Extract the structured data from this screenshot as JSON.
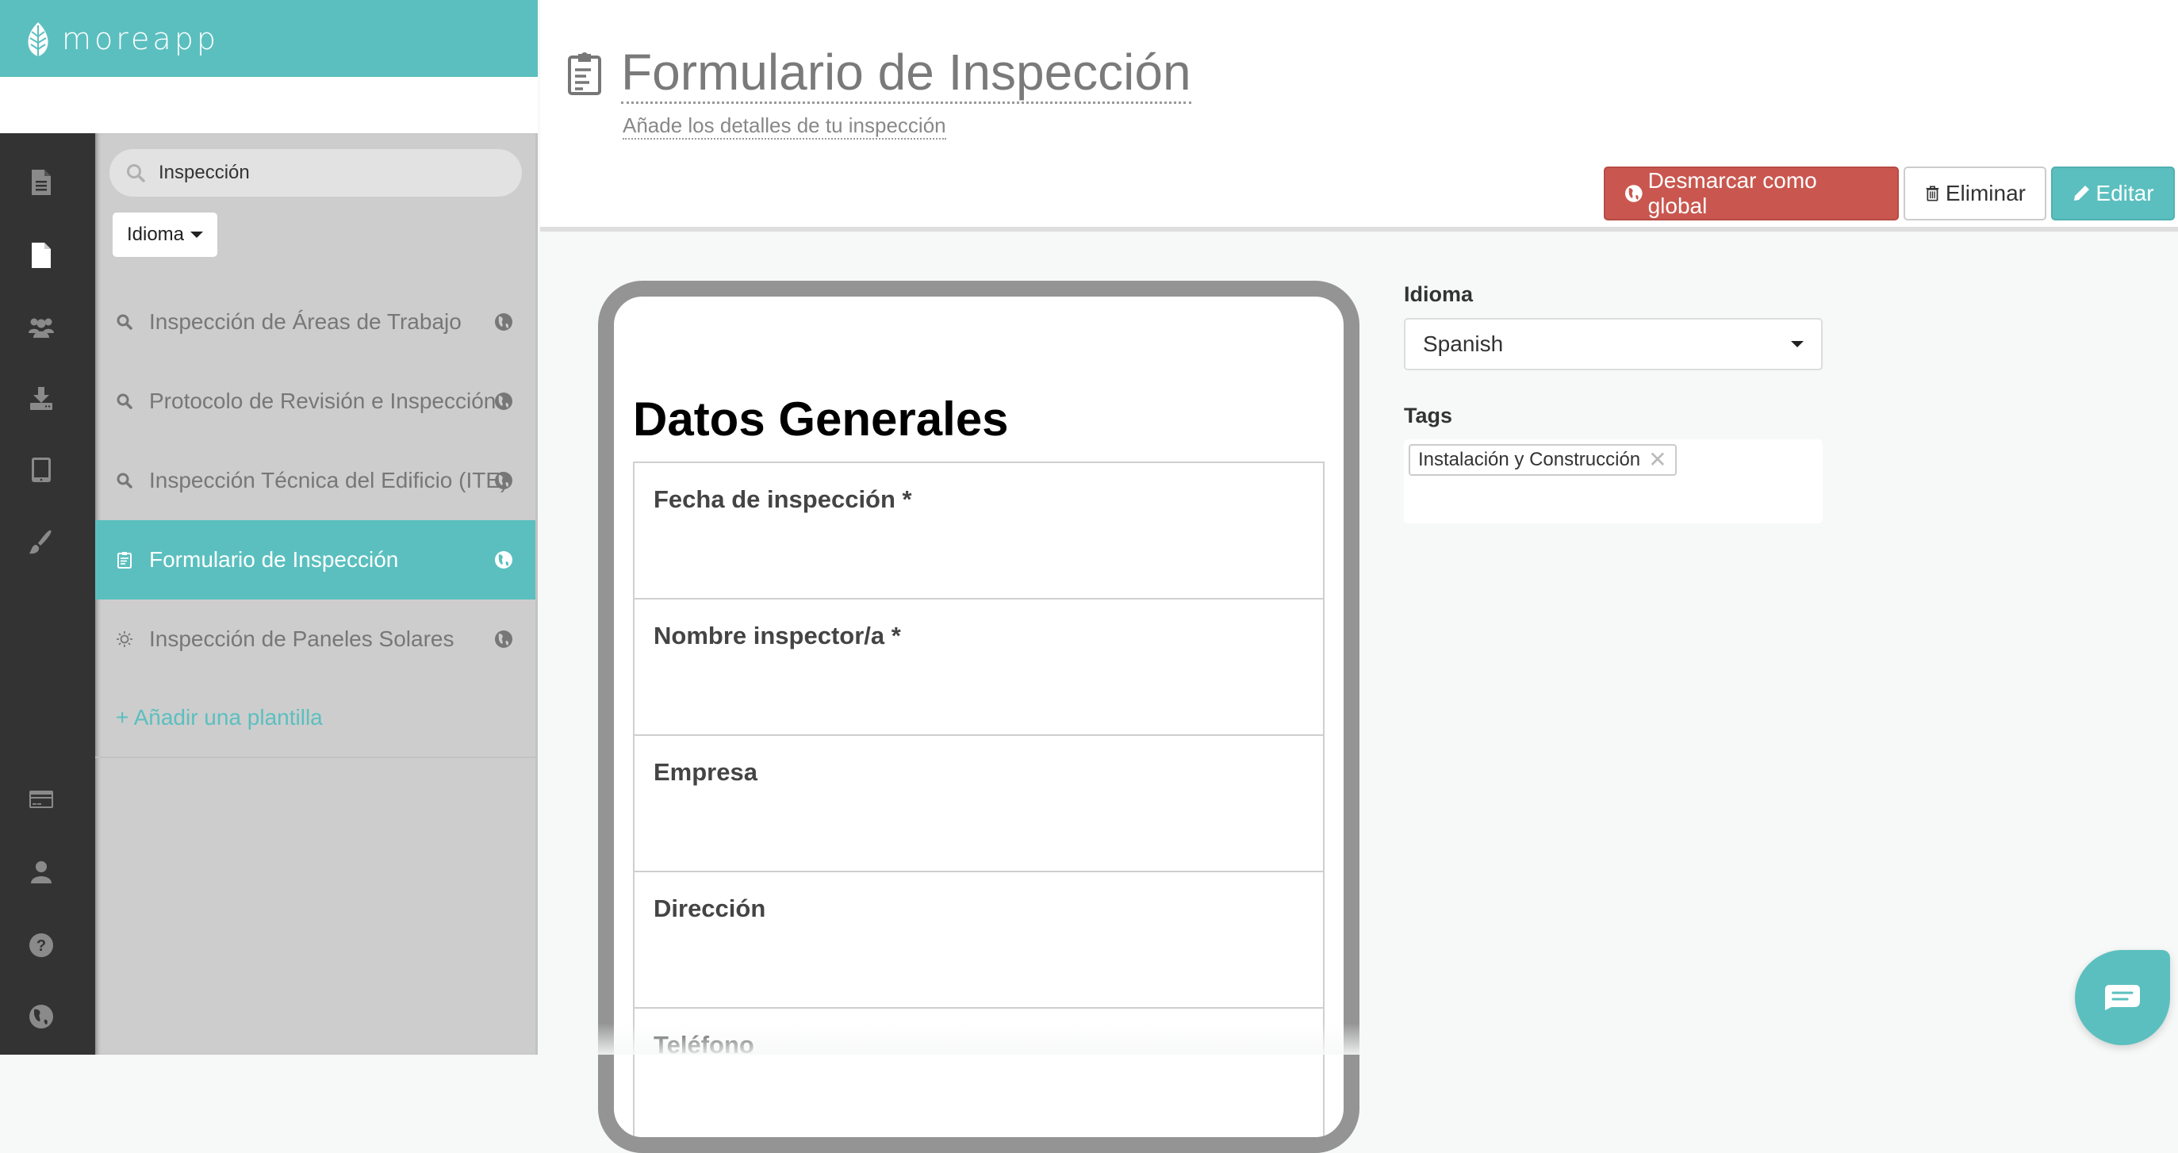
{
  "brand": {
    "name": "moreapp",
    "color": "#5bbfbf"
  },
  "rail": {
    "top_items": [
      {
        "name": "forms-icon",
        "active": false
      },
      {
        "name": "templates-icon",
        "active": true
      },
      {
        "name": "users-icon",
        "active": false
      },
      {
        "name": "submissions-icon",
        "active": false
      },
      {
        "name": "devices-icon",
        "active": false
      },
      {
        "name": "branding-icon",
        "active": false
      }
    ],
    "bottom_items": [
      {
        "name": "billing-icon"
      },
      {
        "name": "profile-icon"
      },
      {
        "name": "help-icon"
      },
      {
        "name": "language-icon"
      }
    ]
  },
  "panel": {
    "search": {
      "value": "Inspección",
      "icon": "search-icon"
    },
    "language_filter": "Idioma",
    "templates": [
      {
        "label": "Inspección de Áreas de Trabajo",
        "icon": "search-icon",
        "global": true,
        "active": false
      },
      {
        "label": "Protocolo de Revisión e Inspección",
        "icon": "search-icon",
        "global": true,
        "active": false
      },
      {
        "label": "Inspección Técnica del Edificio (ITE)",
        "icon": "search-icon",
        "global": true,
        "active": false
      },
      {
        "label": "Formulario de Inspección",
        "icon": "clipboard-icon",
        "global": true,
        "active": true
      },
      {
        "label": "Inspección de Paneles Solares",
        "icon": "sun-icon",
        "global": true,
        "active": false
      }
    ],
    "add_template": "+ Añadir una plantilla"
  },
  "header": {
    "title": "Formulario de Inspección",
    "subtitle": "Añade los detalles de tu inspección",
    "buttons": {
      "unmark_global": "Desmarcar como global",
      "delete": "Eliminar",
      "edit": "Editar"
    },
    "colors": {
      "danger": "#c9574f",
      "primary": "#5bbfbf"
    }
  },
  "preview": {
    "section_title": "Datos Generales",
    "fields": [
      "Fecha de inspección *",
      "Nombre inspector/a *",
      "Empresa",
      "Dirección",
      "Teléfono"
    ]
  },
  "properties": {
    "language_label": "Idioma",
    "language_value": "Spanish",
    "tags_label": "Tags",
    "tags": [
      "Instalación y Construcción"
    ]
  },
  "chat": {
    "icon": "chat-icon"
  }
}
